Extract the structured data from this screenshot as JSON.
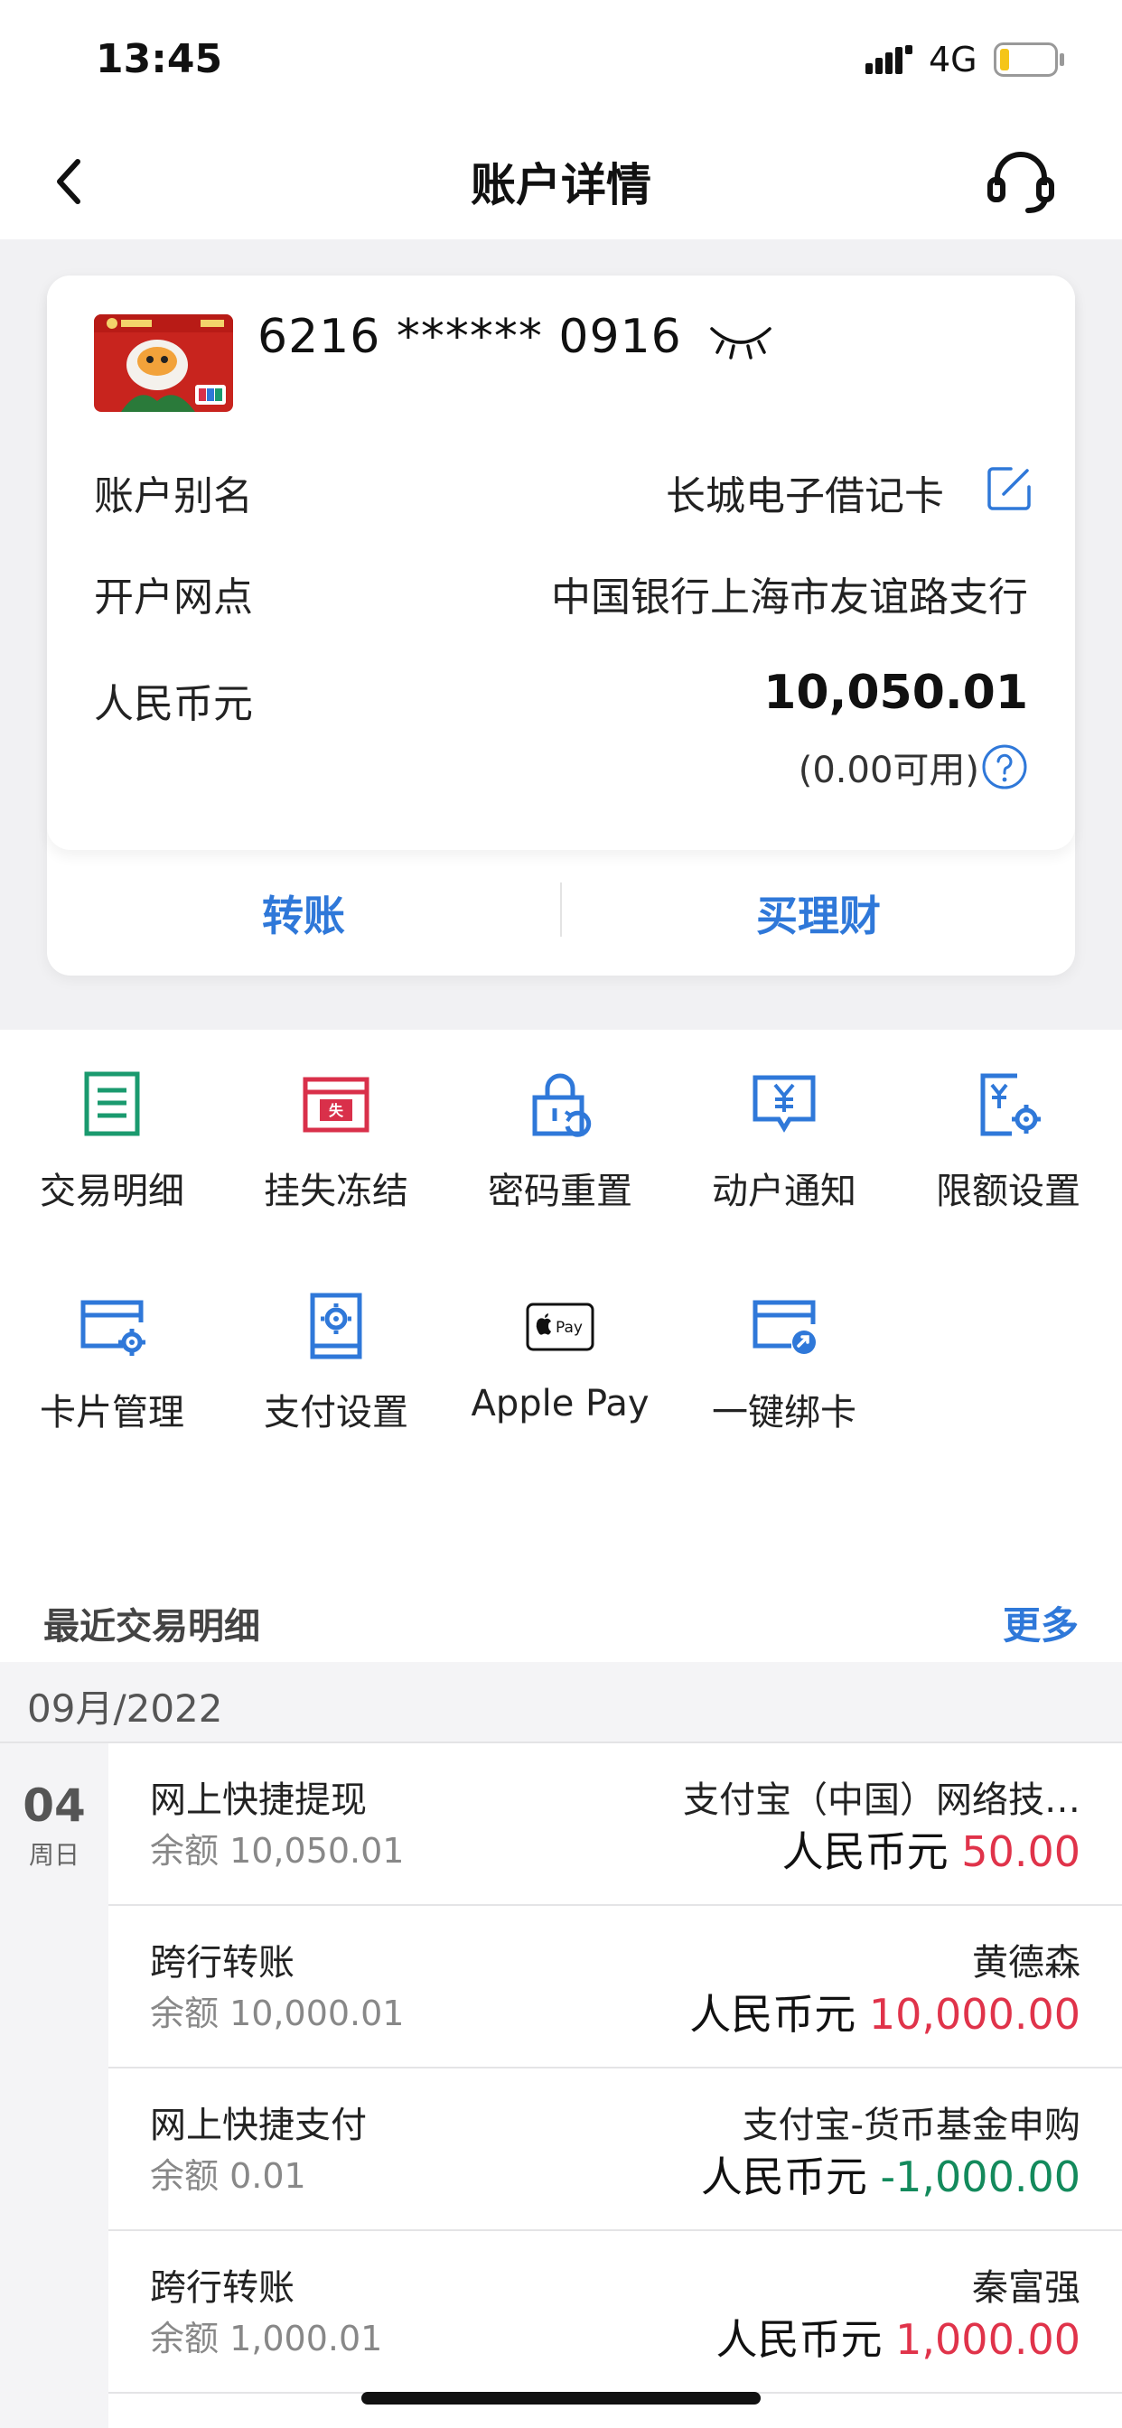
{
  "status_bar": {
    "time": "13:45",
    "network": "4G"
  },
  "nav": {
    "title": "账户详情"
  },
  "card": {
    "number": "6216 ****** 0916",
    "alias_label": "账户别名",
    "alias_value": "长城电子借记卡",
    "branch_label": "开户网点",
    "branch_value": "中国银行上海市友谊路支行",
    "currency_label": "人民币元",
    "balance": "10,050.01",
    "available": "(0.00可用)",
    "actions": {
      "transfer": "转账",
      "buy_wealth": "买理财"
    }
  },
  "functions": [
    {
      "label": "交易明细",
      "icon": "document-list-icon",
      "color": "#1a9a6e"
    },
    {
      "label": "挂失冻结",
      "icon": "report-loss-icon",
      "color": "#d9304a"
    },
    {
      "label": "密码重置",
      "icon": "lock-reset-icon",
      "color": "#2f78d9"
    },
    {
      "label": "动户通知",
      "icon": "yuan-message-icon",
      "color": "#2f78d9"
    },
    {
      "label": "限额设置",
      "icon": "yuan-gear-icon",
      "color": "#2f78d9"
    },
    {
      "label": "卡片管理",
      "icon": "card-gear-icon",
      "color": "#2f78d9"
    },
    {
      "label": "支付设置",
      "icon": "pay-settings-icon",
      "color": "#2f78d9"
    },
    {
      "label": "Apple Pay",
      "icon": "apple-pay-icon",
      "color": "#111111"
    },
    {
      "label": "一键绑卡",
      "icon": "card-link-icon",
      "color": "#2f78d9"
    }
  ],
  "recent": {
    "title": "最近交易明细",
    "more": "更多",
    "month": "09月/2022",
    "day": "04",
    "weekday": "周日",
    "transactions": [
      {
        "type": "网上快捷提现",
        "balance": "余额 10,050.01",
        "party": "支付宝（中国）网络技…",
        "currency": "人民币元",
        "amount": "50.00",
        "direction": "in"
      },
      {
        "type": "跨行转账",
        "balance": "余额 10,000.01",
        "party": "黄德森",
        "currency": "人民币元",
        "amount": "10,000.00",
        "direction": "in"
      },
      {
        "type": "网上快捷支付",
        "balance": "余额 0.01",
        "party": "支付宝-货币基金申购",
        "currency": "人民币元",
        "amount": "-1,000.00",
        "direction": "out"
      },
      {
        "type": "跨行转账",
        "balance": "余额 1,000.01",
        "party": "秦富强",
        "currency": "人民币元",
        "amount": "1,000.00",
        "direction": "in"
      }
    ]
  },
  "colors": {
    "accent": "#2f78d9",
    "income": "#e0334a",
    "expense": "#138a5c",
    "background": "#f1f1f3"
  }
}
